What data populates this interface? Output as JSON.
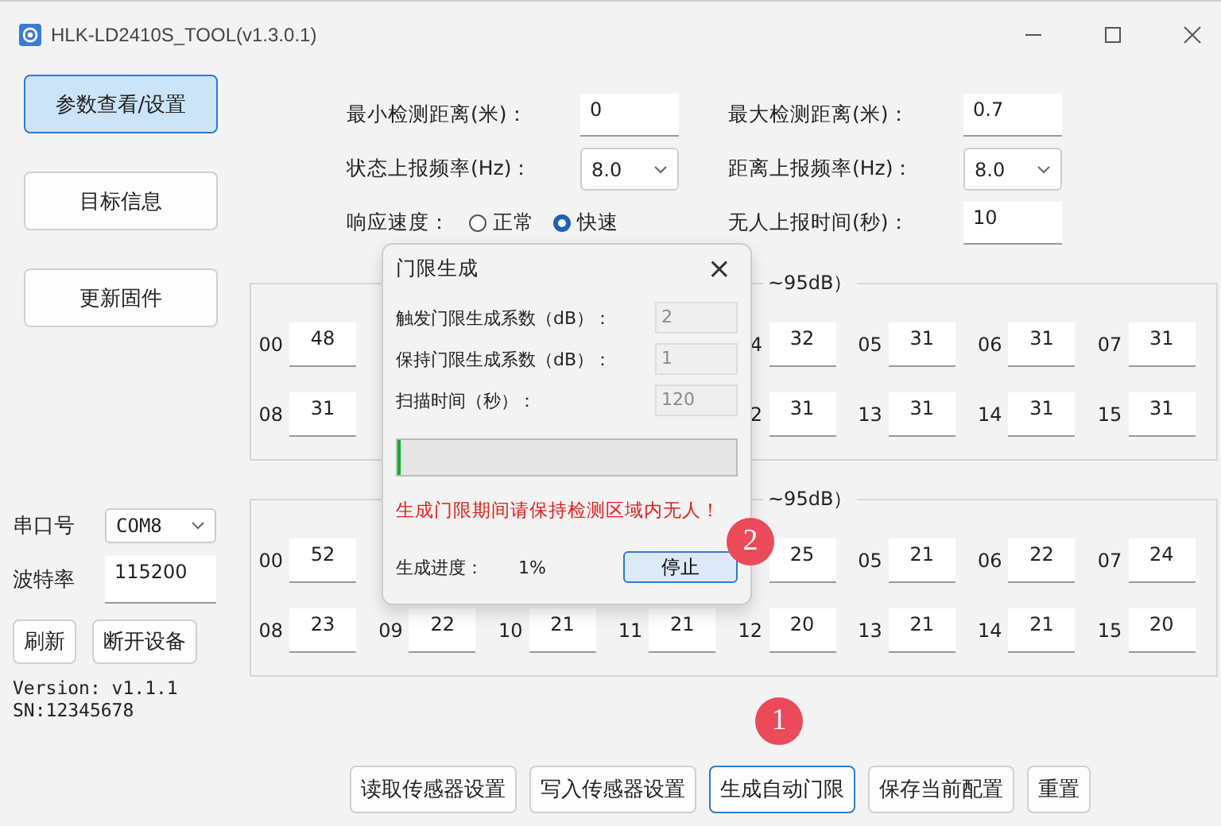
{
  "window": {
    "title": "HLK-LD2410S_TOOL(v1.3.0.1)"
  },
  "nav": [
    {
      "label": "参数查看/设置",
      "selected": true
    },
    {
      "label": "目标信息",
      "selected": false
    },
    {
      "label": "更新固件",
      "selected": false
    }
  ],
  "params": {
    "min_distance": {
      "label": "最小检测距离(米)：",
      "value": "0"
    },
    "max_distance": {
      "label": "最大检测距离(米)：",
      "value": "0.7"
    },
    "state_rate": {
      "label": "状态上报频率(Hz)：",
      "value": "8.0"
    },
    "distance_rate": {
      "label": "距离上报频率(Hz)：",
      "value": "8.0"
    },
    "response": {
      "label": "响应速度：",
      "options": [
        {
          "label": "正常",
          "selected": false
        },
        {
          "label": "快速",
          "selected": true
        }
      ]
    },
    "no_person_time": {
      "label": "无人上报时间(秒)：",
      "value": "10"
    }
  },
  "groups": [
    {
      "title": "~95dB）",
      "rows": [
        [
          {
            "label": "00",
            "value": "48"
          },
          {},
          {},
          {},
          {
            "label": "4",
            "value": "32"
          },
          {
            "label": "05",
            "value": "31"
          },
          {
            "label": "06",
            "value": "31"
          },
          {
            "label": "07",
            "value": "31"
          }
        ],
        [
          {
            "label": "08",
            "value": "31"
          },
          {},
          {},
          {},
          {
            "label": "2",
            "value": "31"
          },
          {
            "label": "13",
            "value": "31"
          },
          {
            "label": "14",
            "value": "31"
          },
          {
            "label": "15",
            "value": "31"
          }
        ]
      ]
    },
    {
      "title": "~95dB）",
      "rows": [
        [
          {
            "label": "00",
            "value": "52"
          },
          {},
          {},
          {},
          {
            "value": "25"
          },
          {
            "label": "05",
            "value": "21"
          },
          {
            "label": "06",
            "value": "22"
          },
          {
            "label": "07",
            "value": "24"
          }
        ],
        [
          {
            "label": "08",
            "value": "23"
          },
          {
            "label": "09",
            "value": "22"
          },
          {
            "label": "10",
            "value": "21"
          },
          {
            "label": "11",
            "value": "21"
          },
          {
            "label": "12",
            "value": "20"
          },
          {
            "label": "13",
            "value": "21"
          },
          {
            "label": "14",
            "value": "21"
          },
          {
            "label": "15",
            "value": "20"
          }
        ]
      ]
    }
  ],
  "serial": {
    "port_label": "串口号",
    "port": "COM8",
    "baud_label": "波特率",
    "baud": "115200",
    "buttons": [
      "刷新",
      "断开设备"
    ]
  },
  "version": "Version: v1.1.1",
  "sn": "SN:12345678",
  "actions": [
    {
      "label": "读取传感器设置",
      "focused": false
    },
    {
      "label": "写入传感器设置",
      "focused": false
    },
    {
      "label": "生成自动门限",
      "focused": true
    },
    {
      "label": "保存当前配置",
      "focused": false
    },
    {
      "label": "重置",
      "focused": false
    }
  ],
  "dialog": {
    "title": "门限生成",
    "close": "×",
    "fields": [
      {
        "label": "触发门限生成系数（dB）：",
        "value": "2"
      },
      {
        "label": "保持门限生成系数（dB）：",
        "value": "1"
      },
      {
        "label": "扫描时间（秒）：",
        "value": "120"
      }
    ],
    "progress": {
      "level": 0.01
    },
    "warning": "生成门限期间请保持检测区域内无人！",
    "progress_label": "生成进度：",
    "progress_value": "1%",
    "stop": "停止"
  },
  "badges": [
    "1",
    "2"
  ]
}
